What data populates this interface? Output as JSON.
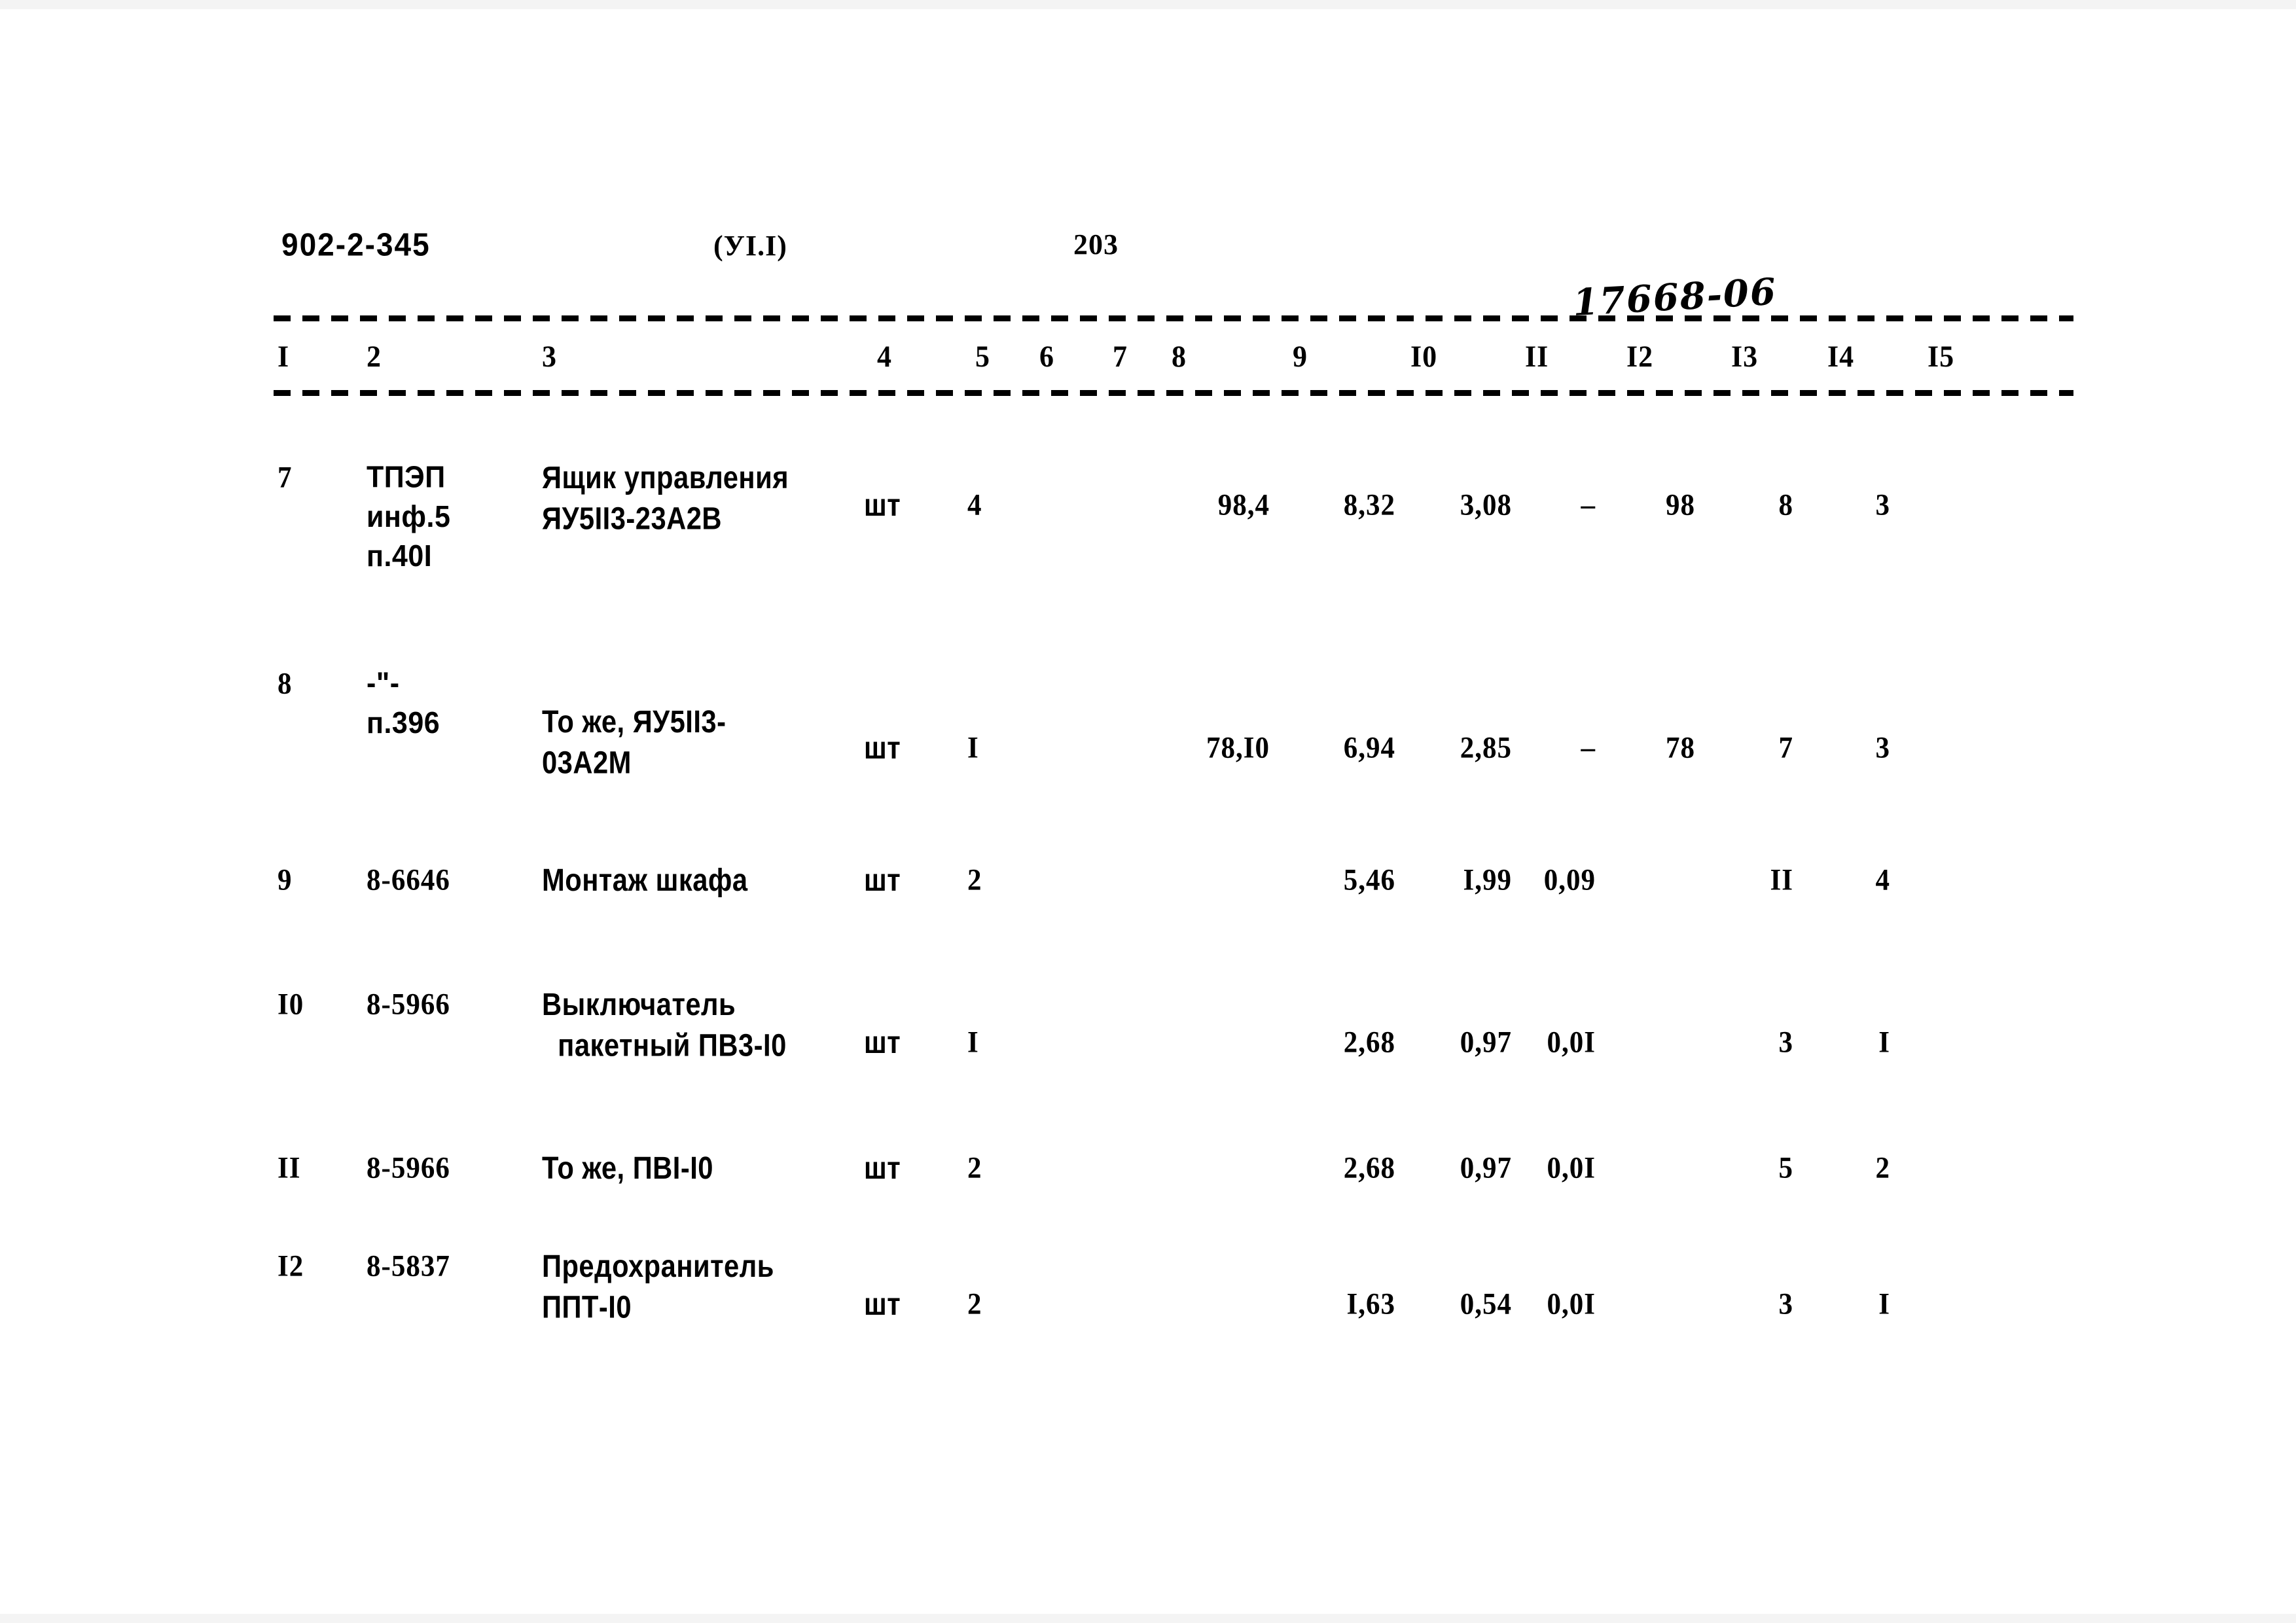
{
  "header": {
    "doc_code": "902-2-345",
    "section": "(УI.I)",
    "page_number": "203",
    "archive_mark": "17668-06"
  },
  "table": {
    "column_numbers": [
      "I",
      "2",
      "3",
      "4",
      "5",
      "6",
      "7",
      "8",
      "9",
      "I0",
      "II",
      "I2",
      "I3",
      "I4",
      "I5"
    ],
    "rows": [
      {
        "c1": "7",
        "c2": "ТПЭП\nинф.5\nп.40I",
        "c3": "Ящик управления\nЯУ5II3-23А2В",
        "c4": "шт",
        "c5": "4",
        "c6": "",
        "c7": "",
        "c8": "98,4",
        "c9": "8,32",
        "c10": "3,08",
        "c11": "–",
        "c12": "98",
        "c13": "8",
        "c14": "3",
        "c15": ""
      },
      {
        "c1": "8",
        "c2": "-\"-\nп.396",
        "c3": "То же, ЯУ5II3-\n03А2М",
        "c4": "шт",
        "c5": "I",
        "c6": "",
        "c7": "",
        "c8": "78,I0",
        "c9": "6,94",
        "c10": "2,85",
        "c11": "–",
        "c12": "78",
        "c13": "7",
        "c14": "3",
        "c15": ""
      },
      {
        "c1": "9",
        "c2": "8-6646",
        "c3": "Монтаж шкафа",
        "c4": "шт",
        "c5": "2",
        "c6": "",
        "c7": "",
        "c8": "",
        "c9": "5,46",
        "c10": "I,99",
        "c11": "0,09",
        "c12": "",
        "c13": "II",
        "c14": "4",
        "c15": ""
      },
      {
        "c1": "I0",
        "c2": "8-5966",
        "c3": "Выключатель\n  пакетный ПВ3-I0",
        "c4": "шт",
        "c5": "I",
        "c6": "",
        "c7": "",
        "c8": "",
        "c9": "2,68",
        "c10": "0,97",
        "c11": "0,0I",
        "c12": "",
        "c13": "3",
        "c14": "I",
        "c15": ""
      },
      {
        "c1": "II",
        "c2": "8-5966",
        "c3": "То же, ПВI-I0",
        "c4": "шт",
        "c5": "2",
        "c6": "",
        "c7": "",
        "c8": "",
        "c9": "2,68",
        "c10": "0,97",
        "c11": "0,0I",
        "c12": "",
        "c13": "5",
        "c14": "2",
        "c15": ""
      },
      {
        "c1": "I2",
        "c2": "8-5837",
        "c3": "Предохранитель\nППТ-I0",
        "c4": "шт",
        "c5": "2",
        "c6": "",
        "c7": "",
        "c8": "",
        "c9": "I,63",
        "c10": "0,54",
        "c11": "0,0I",
        "c12": "",
        "c13": "3",
        "c14": "I",
        "c15": ""
      }
    ]
  }
}
